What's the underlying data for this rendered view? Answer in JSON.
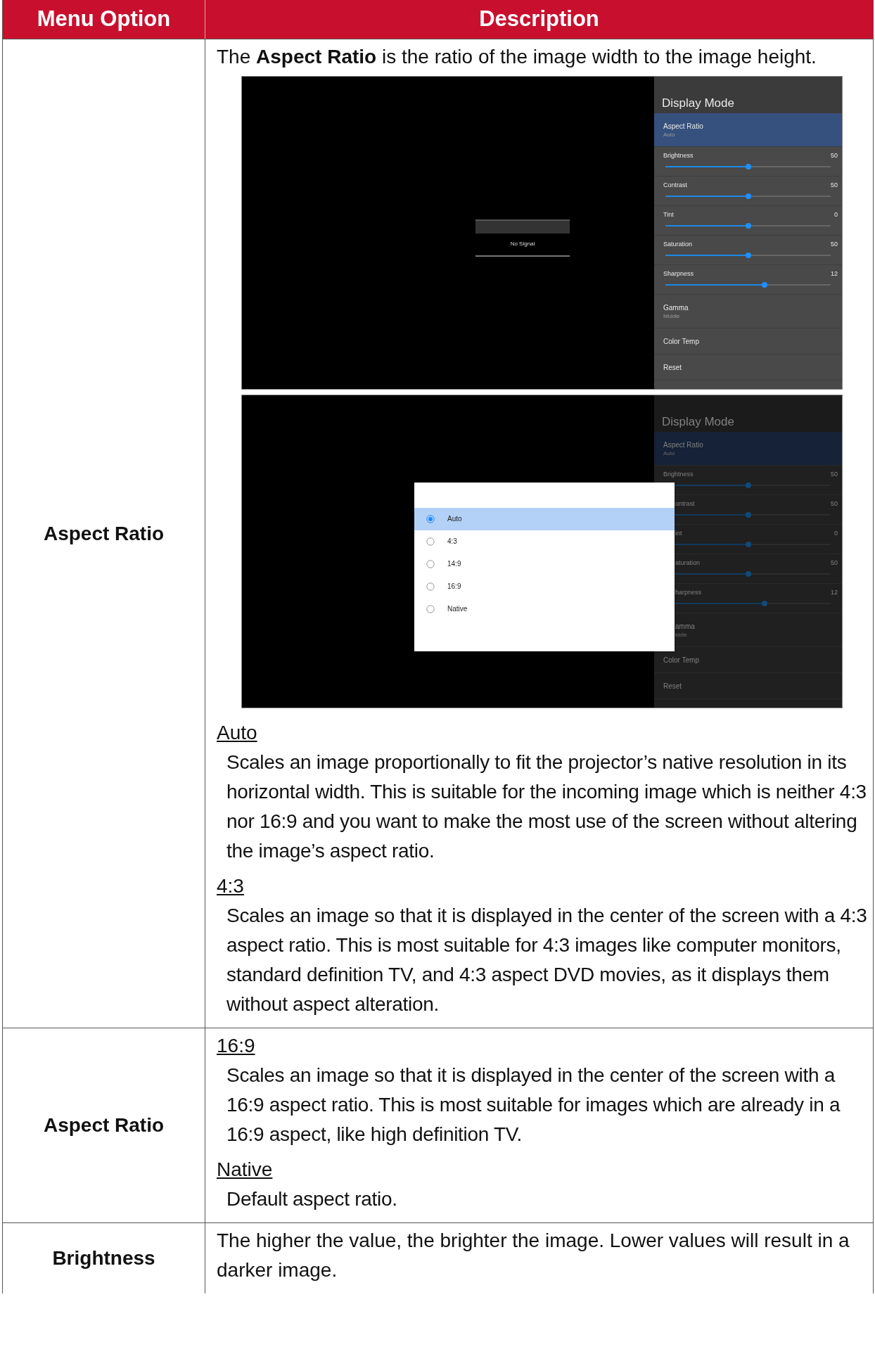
{
  "table": {
    "columns": [
      "Menu Option",
      "Description"
    ],
    "rows": [
      {
        "menu_option": "Aspect Ratio",
        "description": {
          "intro": "The **Aspect Ratio** is the ratio of the image width to the image height.",
          "screenshots": [
            {
              "dimmed": false,
              "signal_message": "No Signal",
              "menu": {
                "title": "Display Mode",
                "items": [
                  {
                    "kind": "option",
                    "label": "Aspect Ratio",
                    "value": "Auto",
                    "selected": true
                  },
                  {
                    "kind": "slider",
                    "label": "Brightness",
                    "reading": "50",
                    "level": 0.5,
                    "selected": false
                  },
                  {
                    "kind": "slider",
                    "label": "Contrast",
                    "reading": "50",
                    "level": 0.5,
                    "selected": false
                  },
                  {
                    "kind": "slider",
                    "label": "Tint",
                    "reading": "0",
                    "level": 0.5,
                    "selected": false
                  },
                  {
                    "kind": "slider",
                    "label": "Saturation",
                    "reading": "50",
                    "level": 0.5,
                    "selected": false
                  },
                  {
                    "kind": "slider",
                    "label": "Sharpness",
                    "reading": "12",
                    "level": 0.6,
                    "selected": false
                  },
                  {
                    "kind": "option",
                    "label": "Gamma",
                    "value": "Middle",
                    "selected": false
                  },
                  {
                    "kind": "action",
                    "label": "Color Temp",
                    "selected": false
                  },
                  {
                    "kind": "action",
                    "label": "Reset",
                    "selected": false
                  }
                ]
              }
            },
            {
              "dimmed": true,
              "menu": {
                "title": "Display Mode",
                "items": [
                  {
                    "kind": "option",
                    "label": "Aspect Ratio",
                    "value": "Auto",
                    "selected": true
                  },
                  {
                    "kind": "slider",
                    "label": "Brightness",
                    "reading": "50",
                    "level": 0.5,
                    "selected": false
                  },
                  {
                    "kind": "slider",
                    "label": "ontrast",
                    "reading": "50",
                    "level": 0.5,
                    "selected": false,
                    "covered": true
                  },
                  {
                    "kind": "slider",
                    "label": "int",
                    "reading": "0",
                    "level": 0.5,
                    "selected": false,
                    "covered": true
                  },
                  {
                    "kind": "slider",
                    "label": "aturation",
                    "reading": "50",
                    "level": 0.5,
                    "selected": false,
                    "covered": true
                  },
                  {
                    "kind": "slider",
                    "label": "harpness",
                    "reading": "12",
                    "level": 0.6,
                    "selected": false,
                    "covered": true
                  },
                  {
                    "kind": "option",
                    "label": "amma",
                    "value": "iddle",
                    "selected": false,
                    "covered": true
                  },
                  {
                    "kind": "action",
                    "label": "Color Temp",
                    "selected": false
                  },
                  {
                    "kind": "action",
                    "label": "Reset",
                    "selected": false
                  }
                ]
              },
              "dialog": {
                "options": [
                  {
                    "label": "Auto",
                    "selected": true
                  },
                  {
                    "label": "4:3",
                    "selected": false
                  },
                  {
                    "label": "14:9",
                    "selected": false
                  },
                  {
                    "label": "16:9",
                    "selected": false
                  },
                  {
                    "label": "Native",
                    "selected": false
                  }
                ]
              }
            }
          ],
          "options": [
            {
              "name": "Auto",
              "text": "Scales an image proportionally to fit the projector’s native resolution in its horizontal width. This is suitable for the incoming image which is neither 4:3 nor 16:9 and you want to make the most use of the screen without altering the image’s aspect ratio."
            },
            {
              "name": "4:3",
              "text": "Scales an image so that it is displayed in the center of the screen with a 4:3 aspect ratio. This is most suitable for 4:3 images like computer monitors, standard definition TV, and 4:3 aspect DVD movies, as it displays them without aspect alteration."
            }
          ]
        }
      },
      {
        "menu_option": "Aspect Ratio",
        "description": {
          "options": [
            {
              "name": "16:9",
              "text": "Scales an image so that it is displayed in the center of the screen with a 16:9 aspect ratio. This is most suitable for images which are already in a 16:9 aspect, like high definition TV."
            },
            {
              "name": "Native",
              "text": "Default aspect ratio."
            }
          ]
        }
      },
      {
        "menu_option": "Brightness",
        "description": {
          "intro": "The higher the value, the brighter the image. Lower values will result in a darker image."
        }
      }
    ]
  }
}
